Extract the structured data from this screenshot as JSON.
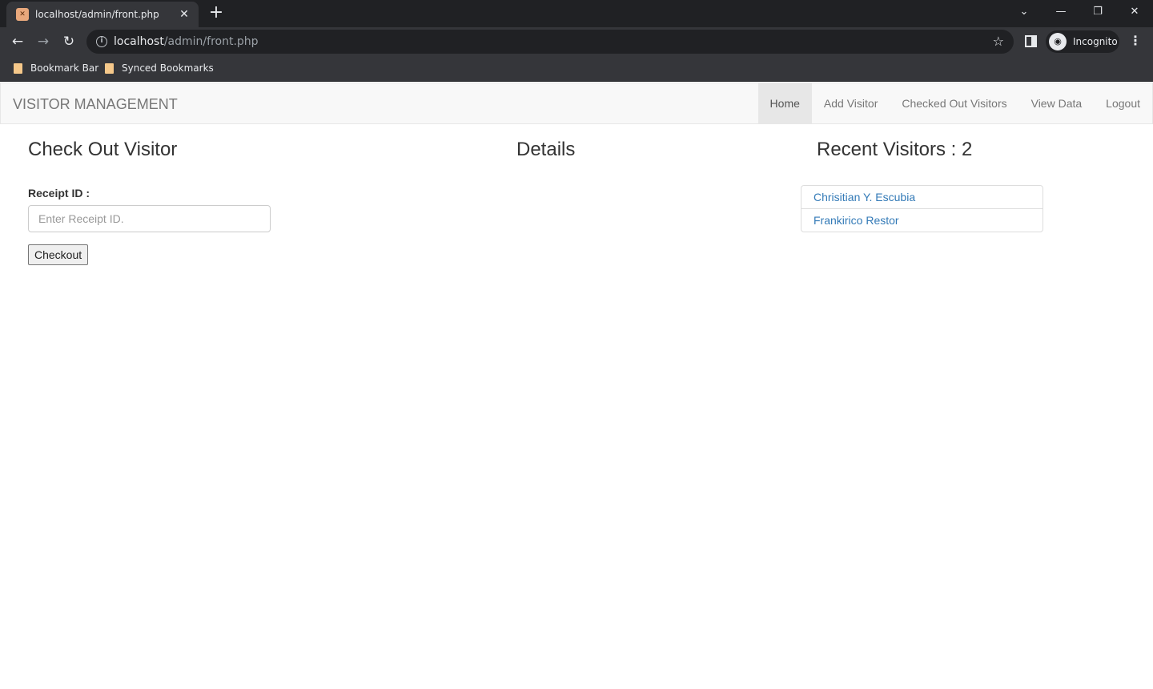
{
  "browser": {
    "tab_title": "localhost/admin/front.php",
    "url_host": "localhost",
    "url_path": "/admin/front.php",
    "profile_label": "Incognito",
    "bookmarks": [
      "Bookmark Bar",
      "Synced Bookmarks"
    ],
    "icons": {
      "favicon": "xampp-favicon",
      "back": "arrow-left-icon",
      "forward": "arrow-right-icon",
      "reload": "reload-icon",
      "info": "info-icon",
      "star": "star-icon",
      "menu": "kebab-menu-icon"
    }
  },
  "navbar": {
    "brand": "VISITOR MANAGEMENT",
    "links": [
      "Home",
      "Add Visitor",
      "Checked Out Visitors",
      "View Data",
      "Logout"
    ],
    "active": "Home"
  },
  "checkout": {
    "title": "Check Out Visitor",
    "label": "Receipt ID :",
    "placeholder": "Enter Receipt ID.",
    "value": "",
    "button": "Checkout"
  },
  "details": {
    "title": "Details"
  },
  "recent": {
    "title": "Recent Visitors : 2",
    "visitors": [
      "Chrisitian Y. Escubia",
      "Frankirico Restor"
    ]
  },
  "colors": {
    "link": "#337ab7",
    "navbar_bg": "#f8f8f8",
    "chrome_dark": "#202124",
    "chrome_toolbar": "#35363a"
  }
}
